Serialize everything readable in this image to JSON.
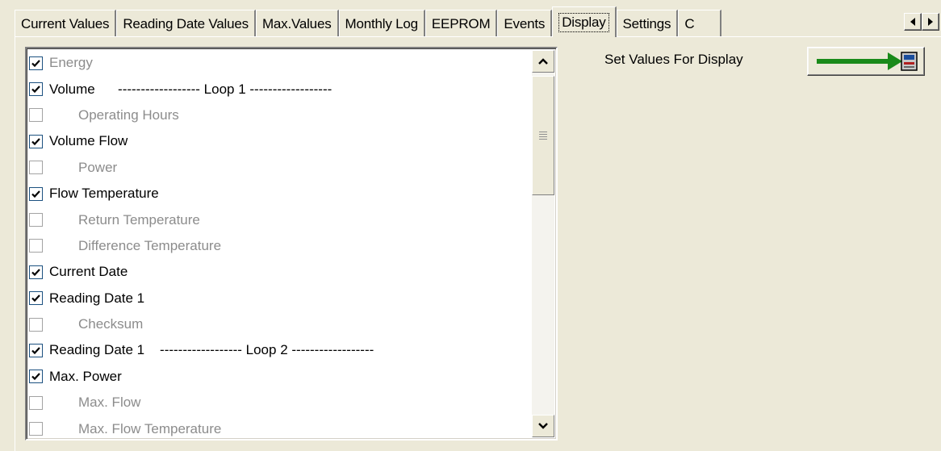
{
  "tabs": [
    {
      "label": "Current Values",
      "active": false
    },
    {
      "label": "Reading Date Values",
      "active": false
    },
    {
      "label": "Max.Values",
      "active": false
    },
    {
      "label": "Monthly Log",
      "active": false
    },
    {
      "label": "EEPROM",
      "active": false
    },
    {
      "label": "Events",
      "active": false
    },
    {
      "label": "Display",
      "active": true
    },
    {
      "label": "Settings",
      "active": false
    },
    {
      "label": "C",
      "active": false
    }
  ],
  "display_list": {
    "items": [
      {
        "label": "Energy",
        "checked": true,
        "dim": true,
        "indent": false
      },
      {
        "label": "Volume      ------------------ Loop 1 ------------------",
        "checked": true,
        "dim": false,
        "indent": false
      },
      {
        "label": "Operating Hours",
        "checked": false,
        "dim": true,
        "indent": true
      },
      {
        "label": "Volume Flow",
        "checked": true,
        "dim": false,
        "indent": false
      },
      {
        "label": "Power",
        "checked": false,
        "dim": true,
        "indent": true
      },
      {
        "label": "Flow Temperature",
        "checked": true,
        "dim": false,
        "indent": false
      },
      {
        "label": "Return Temperature",
        "checked": false,
        "dim": true,
        "indent": true
      },
      {
        "label": "Difference Temperature",
        "checked": false,
        "dim": true,
        "indent": true
      },
      {
        "label": "Current Date",
        "checked": true,
        "dim": false,
        "indent": false
      },
      {
        "label": "Reading Date 1",
        "checked": true,
        "dim": false,
        "indent": false
      },
      {
        "label": "Checksum",
        "checked": false,
        "dim": true,
        "indent": true
      },
      {
        "label": "Reading Date 1    ------------------ Loop 2 ------------------",
        "checked": true,
        "dim": false,
        "indent": false
      },
      {
        "label": "Max. Power",
        "checked": true,
        "dim": false,
        "indent": false
      },
      {
        "label": "Max. Flow",
        "checked": false,
        "dim": true,
        "indent": true
      },
      {
        "label": "Max. Flow Temperature",
        "checked": false,
        "dim": true,
        "indent": true
      }
    ]
  },
  "set_values": {
    "label": "Set Values For Display",
    "button_icon": "arrow-to-meter-icon"
  },
  "colors": {
    "arrow": "#1a8a1a",
    "dim_text": "#8c8c8c",
    "panel": "#ece9d8"
  }
}
